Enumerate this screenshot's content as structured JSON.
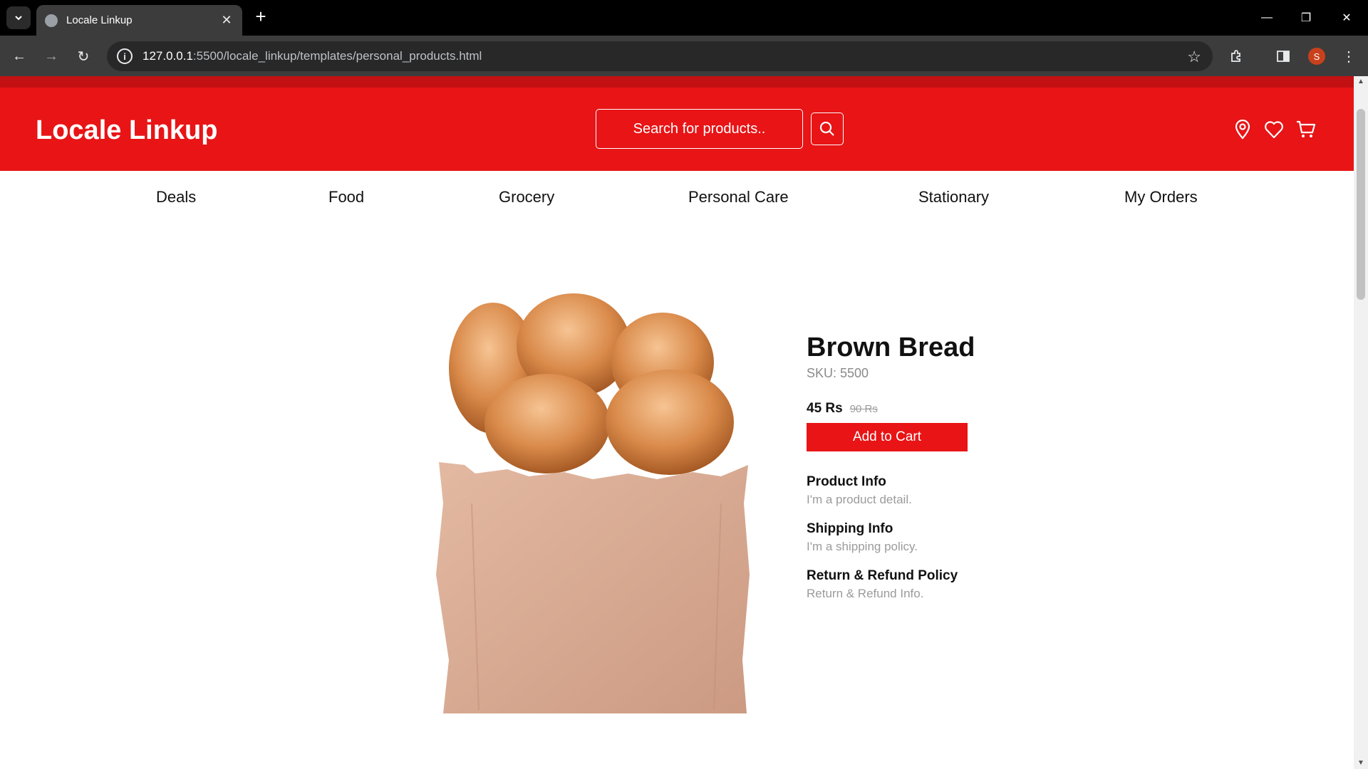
{
  "browser": {
    "tab_title": "Locale Linkup",
    "url_host": "127.0.0.1",
    "url_path": ":5500/locale_linkup/templates/personal_products.html",
    "profile_initial": "S"
  },
  "header": {
    "logo": "Locale Linkup",
    "search_placeholder": "Search for products..",
    "icons": [
      "location-pin-icon",
      "heart-icon",
      "cart-icon"
    ],
    "accent_color": "#e81416"
  },
  "nav": {
    "items": [
      {
        "label": "Deals"
      },
      {
        "label": "Food"
      },
      {
        "label": "Grocery"
      },
      {
        "label": "Personal Care"
      },
      {
        "label": "Stationary"
      },
      {
        "label": "My Orders"
      }
    ]
  },
  "product": {
    "title": "Brown Bread",
    "sku": "SKU: 5500",
    "price": "45 Rs",
    "old_price": "90 Rs",
    "add_to_cart": "Add to Cart",
    "sections": [
      {
        "heading": "Product Info",
        "text": "I'm a product detail."
      },
      {
        "heading": "Shipping Info",
        "text": "I'm a shipping policy."
      },
      {
        "heading": "Return & Refund Policy",
        "text": "Return & Refund Info."
      }
    ]
  }
}
